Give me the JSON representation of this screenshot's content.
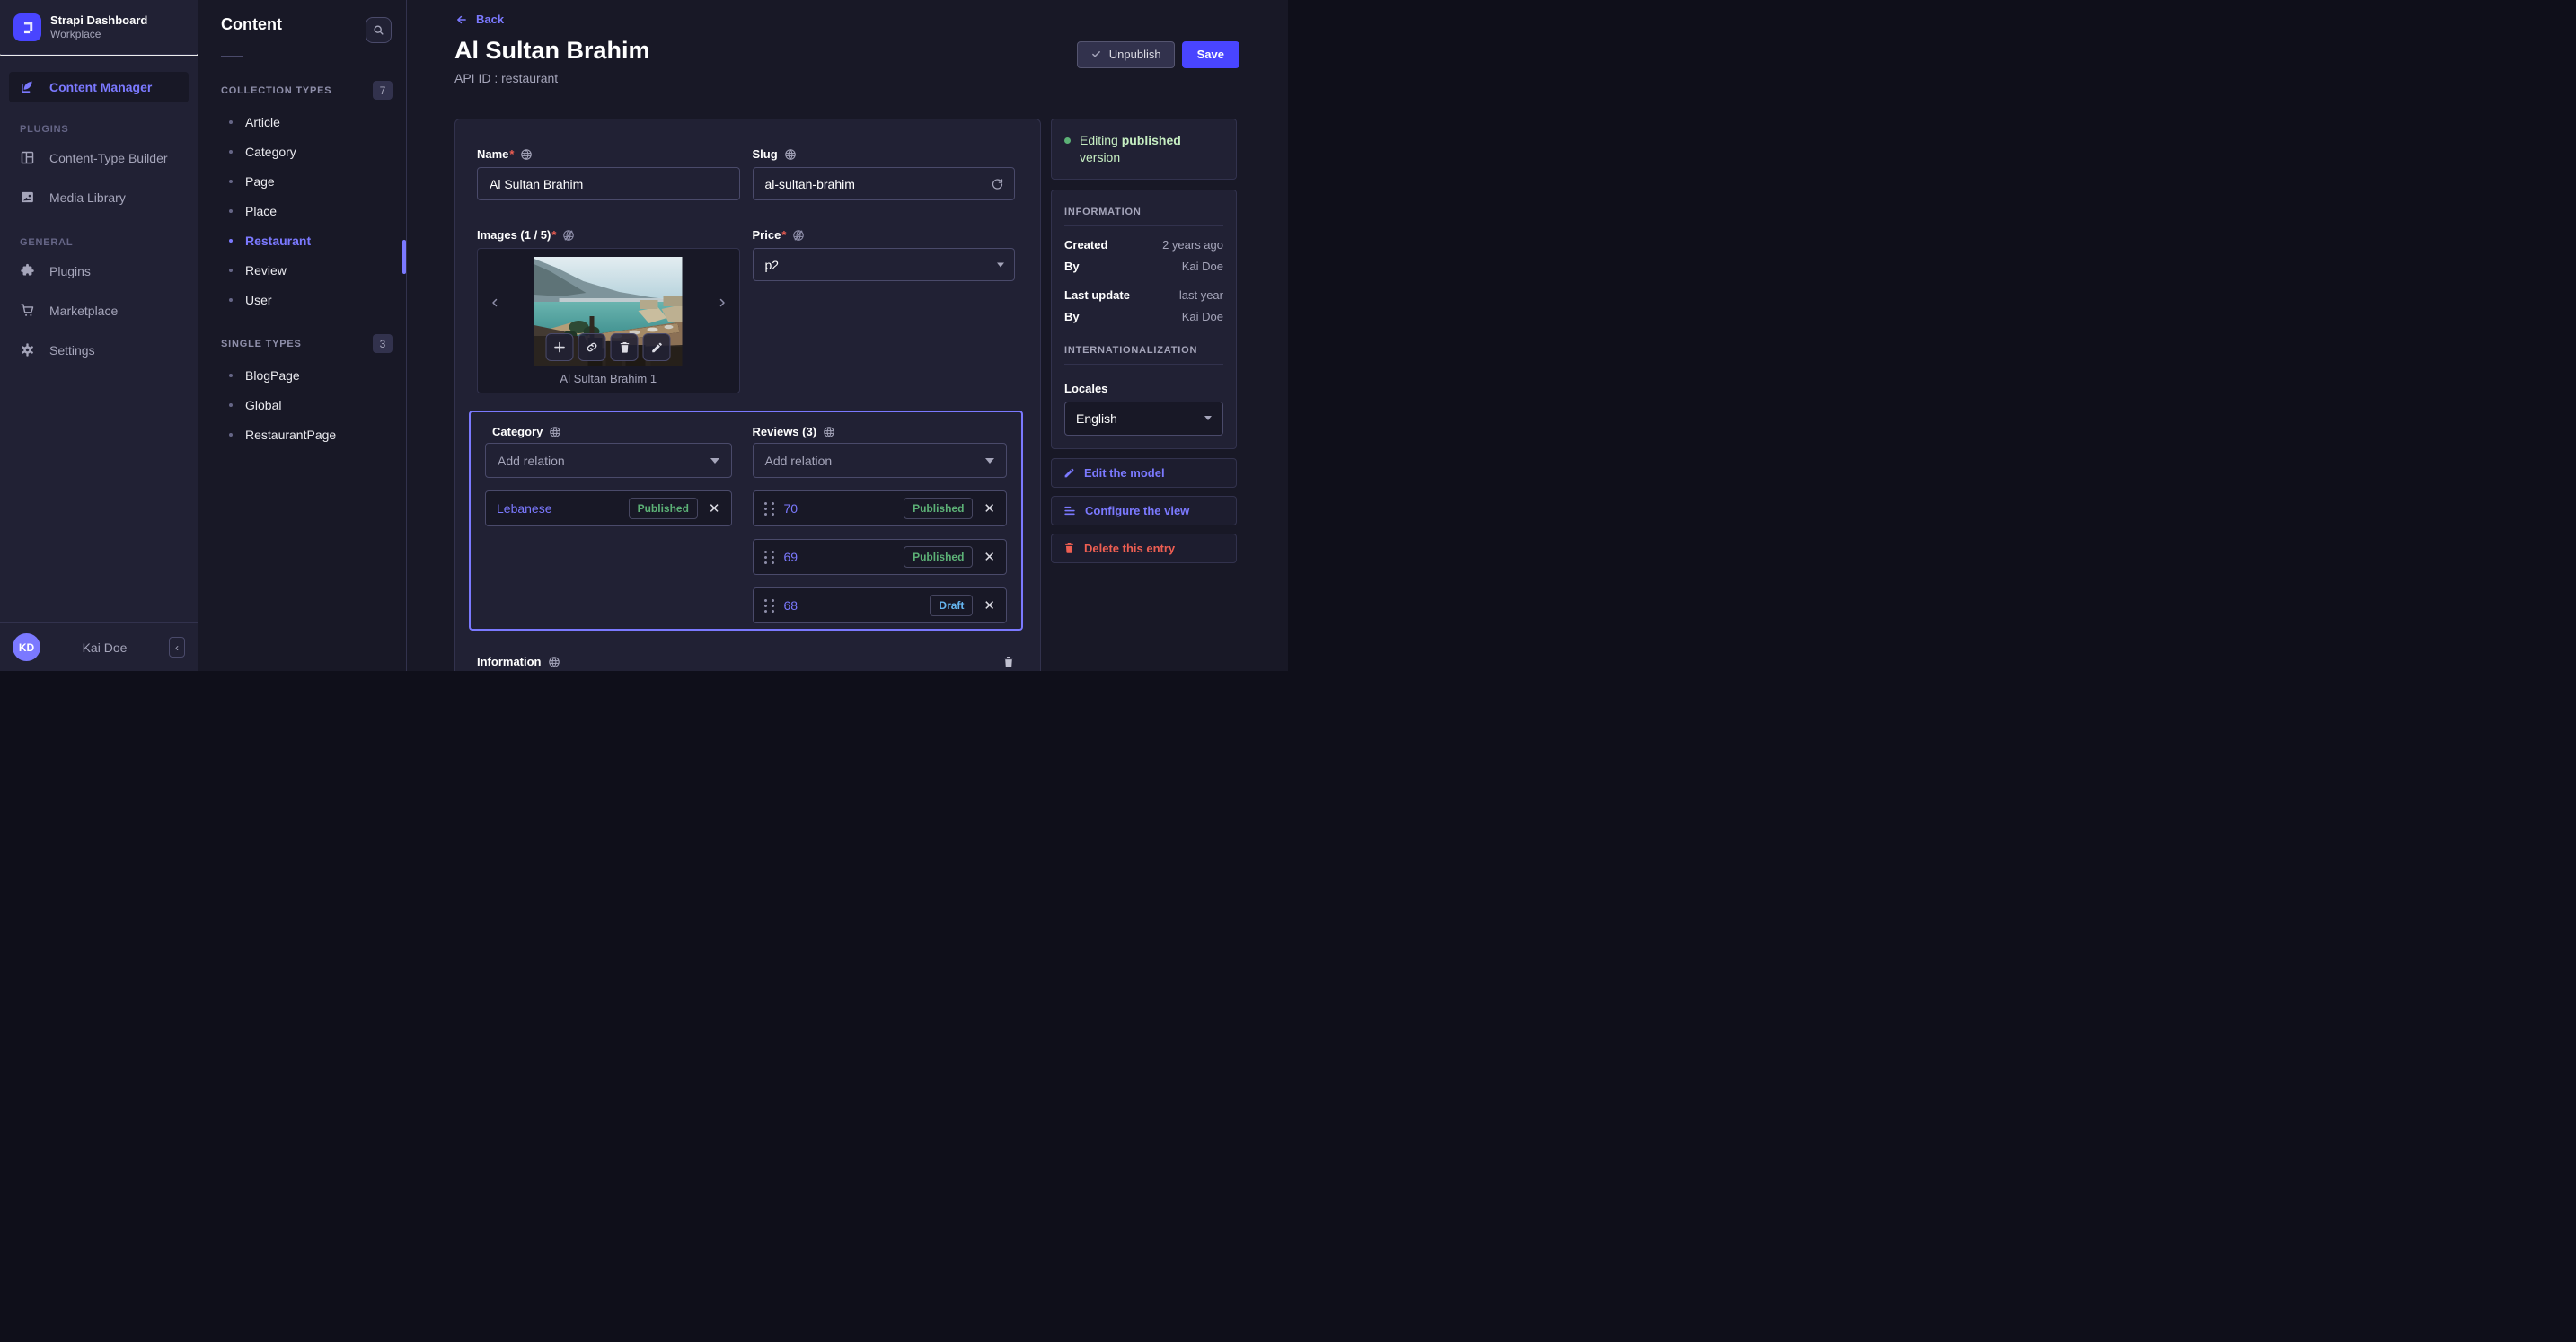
{
  "theme": {
    "accent": "#4945ff",
    "accent_light": "#7b79ff",
    "bg": "#181826",
    "panel": "#212134",
    "border": "#32324d",
    "border_strong": "#4a4a6a",
    "danger": "#ee5e52",
    "success": "#5cb176",
    "draft_blue": "#66b7f1",
    "muted": "#a5a5ba"
  },
  "sidebar": {
    "app_title": "Strapi Dashboard",
    "workspace": "Workplace",
    "content_manager": "Content Manager",
    "plugins_heading": "PLUGINS",
    "content_type_builder": "Content-Type Builder",
    "media_library": "Media Library",
    "general_heading": "GENERAL",
    "plugins": "Plugins",
    "marketplace": "Marketplace",
    "settings": "Settings",
    "user_initials": "KD",
    "user_name": "Kai Doe",
    "collapse_glyph": "‹"
  },
  "subnav": {
    "title": "Content",
    "collection_heading": "COLLECTION TYPES",
    "collection_count": "7",
    "collection_items": [
      "Article",
      "Category",
      "Page",
      "Place",
      "Restaurant",
      "Review",
      "User"
    ],
    "single_heading": "SINGLE TYPES",
    "single_count": "3",
    "single_items": [
      "BlogPage",
      "Global",
      "RestaurantPage"
    ]
  },
  "header": {
    "back": "Back",
    "title": "Al Sultan Brahim",
    "api_id": "API ID : restaurant",
    "unpublish": "Unpublish",
    "save": "Save"
  },
  "form": {
    "required_mark": "*",
    "name_label": "Name",
    "name_value": "Al Sultan Brahim",
    "slug_label": "Slug",
    "slug_value": "al-sultan-brahim",
    "images_label": "Images (1 / 5)",
    "image_caption": "Al Sultan Brahim 1",
    "price_label": "Price",
    "price_value": "p2",
    "category_label": "Category",
    "reviews_label": "Reviews (3)",
    "add_relation_placeholder": "Add relation",
    "category_relations": [
      {
        "name": "Lebanese",
        "status": "Published"
      }
    ],
    "review_relations": [
      {
        "name": "70",
        "status": "Published"
      },
      {
        "name": "69",
        "status": "Published"
      },
      {
        "name": "68",
        "status": "Draft"
      }
    ],
    "information_label": "Information"
  },
  "aside": {
    "editing_prefix": "Editing ",
    "editing_bold": "published",
    "editing_suffix": " version",
    "information_heading": "INFORMATION",
    "created_label": "Created",
    "created_value": "2 years ago",
    "created_by_label": "By",
    "created_by_value": "Kai Doe",
    "updated_label": "Last update",
    "updated_value": "last year",
    "updated_by_label": "By",
    "updated_by_value": "Kai Doe",
    "i18n_heading": "INTERNATIONALIZATION",
    "locales_label": "Locales",
    "locale_value": "English",
    "edit_model": "Edit the model",
    "configure_view": "Configure the view",
    "delete_entry": "Delete this entry"
  }
}
